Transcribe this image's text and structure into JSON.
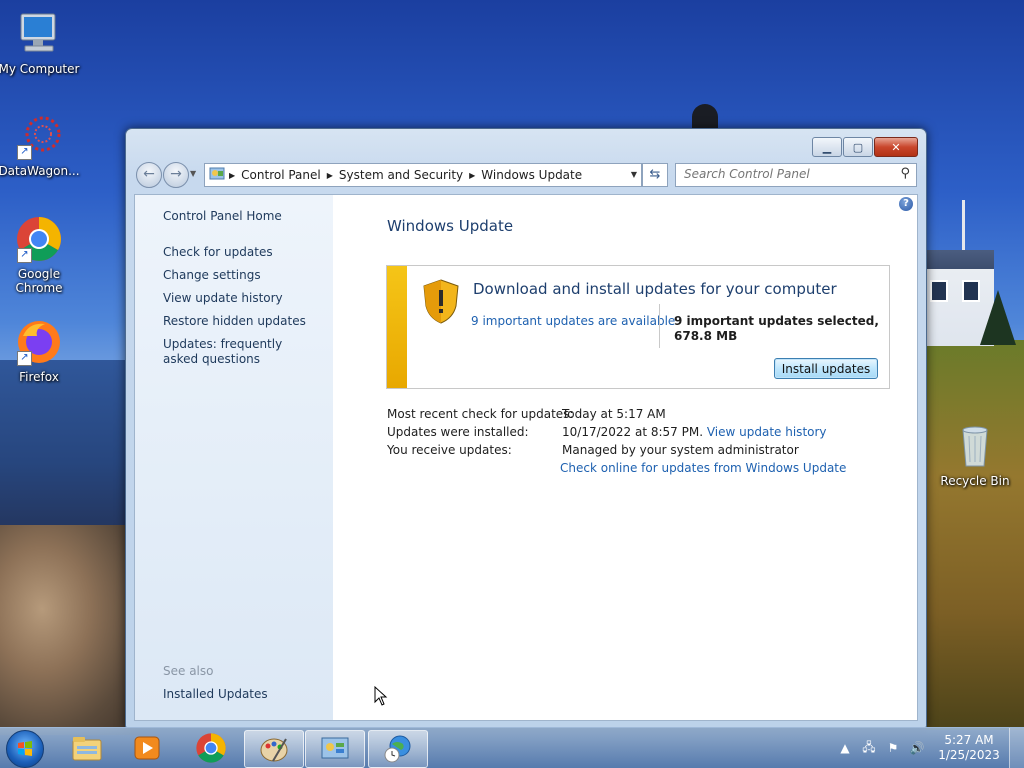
{
  "desktop": {
    "icons": [
      {
        "label": "My Computer",
        "icon": "computer-icon"
      },
      {
        "label": "DataWagon...",
        "icon": "datawagon-icon"
      },
      {
        "label": "Google\nChrome",
        "icon": "chrome-icon"
      },
      {
        "label": "Firefox",
        "icon": "firefox-icon"
      },
      {
        "label": "Recycle Bin",
        "icon": "recycle-bin-icon"
      }
    ]
  },
  "window": {
    "address": {
      "crumbs": [
        "Control Panel",
        "System and Security",
        "Windows Update"
      ]
    },
    "search_placeholder": "Search Control Panel",
    "left_pane": {
      "home": "Control Panel Home",
      "links": [
        "Check for updates",
        "Change settings",
        "View update history",
        "Restore hidden updates",
        "Updates: frequently asked questions"
      ],
      "see_also_header": "See also",
      "see_also": [
        "Installed Updates"
      ]
    },
    "main": {
      "title": "Windows Update",
      "panel": {
        "heading": "Download and install updates for your computer",
        "available_link": "9 important updates are available",
        "selected_text": "9 important updates selected, 678.8 MB",
        "install_button": "Install updates"
      },
      "info": [
        {
          "key": "Most recent check for updates:",
          "value": "Today at 5:17 AM",
          "link": ""
        },
        {
          "key": "Updates were installed:",
          "value": "10/17/2022 at 8:57 PM.",
          "link": "View update history"
        },
        {
          "key": "You receive updates:",
          "value": "Managed by your system administrator",
          "link": ""
        }
      ],
      "check_online_link": "Check online for updates from Windows Update"
    }
  },
  "taskbar": {
    "clock_time": "5:27 AM",
    "clock_date": "1/25/2023",
    "pinned": [
      "explorer-icon",
      "media-player-icon",
      "chrome-icon",
      "paint-icon",
      "control-panel-icon",
      "internet-time-icon"
    ]
  }
}
